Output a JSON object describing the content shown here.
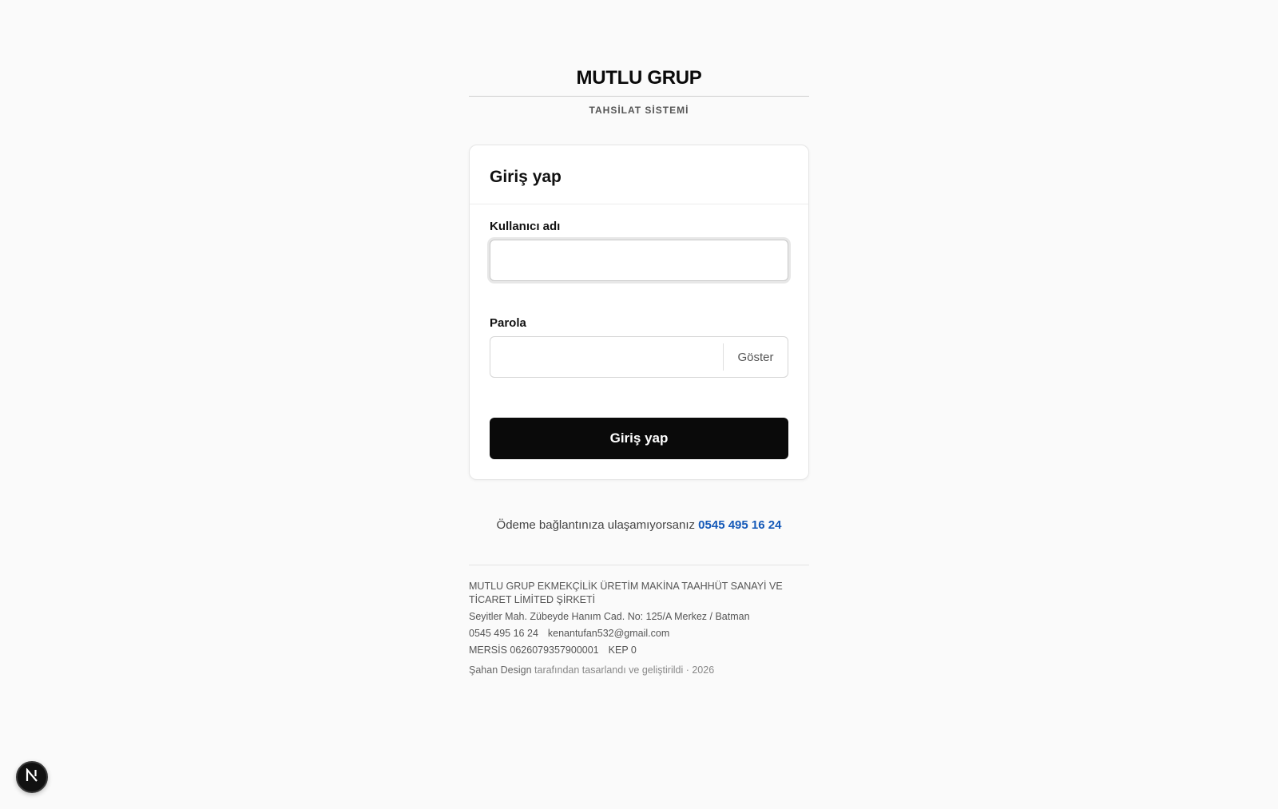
{
  "header": {
    "brand": "MUTLU GRUP",
    "subtitle": "TAHSİLAT SİSTEMİ"
  },
  "login_card": {
    "title": "Giriş yap",
    "username_label": "Kullanıcı adı",
    "username_value": "",
    "password_label": "Parola",
    "password_value": "",
    "show_password_label": "Göster",
    "submit_label": "Giriş yap"
  },
  "help": {
    "text": "Ödeme bağlantınıza ulaşamıyorsanız",
    "phone_link": "0545 495 16 24"
  },
  "footer": {
    "company_name": "MUTLU GRUP EKMEKÇİLİK ÜRETİM MAKİNA TAAHHÜT SANAYİ VE TİCARET LİMİTED ŞİRKETİ",
    "address": "Seyitler Mah. Zübeyde Hanım Cad. No: 125/A Merkez / Batman",
    "phone": "0545 495 16 24",
    "email": "kenantufan532@gmail.com",
    "mersis": "MERSİS 0626079357900001",
    "kep": "KEP 0",
    "credit_brand": "Şahan Design",
    "credit_text": "tarafından tasarlandı ve geliştirildi · 2026"
  },
  "dev_badge": {
    "icon": "nextjs-logo-icon",
    "letter": "N"
  },
  "colors": {
    "background": "#fafafa",
    "primary_button": "#0a0a0a",
    "link": "#1459b8"
  }
}
